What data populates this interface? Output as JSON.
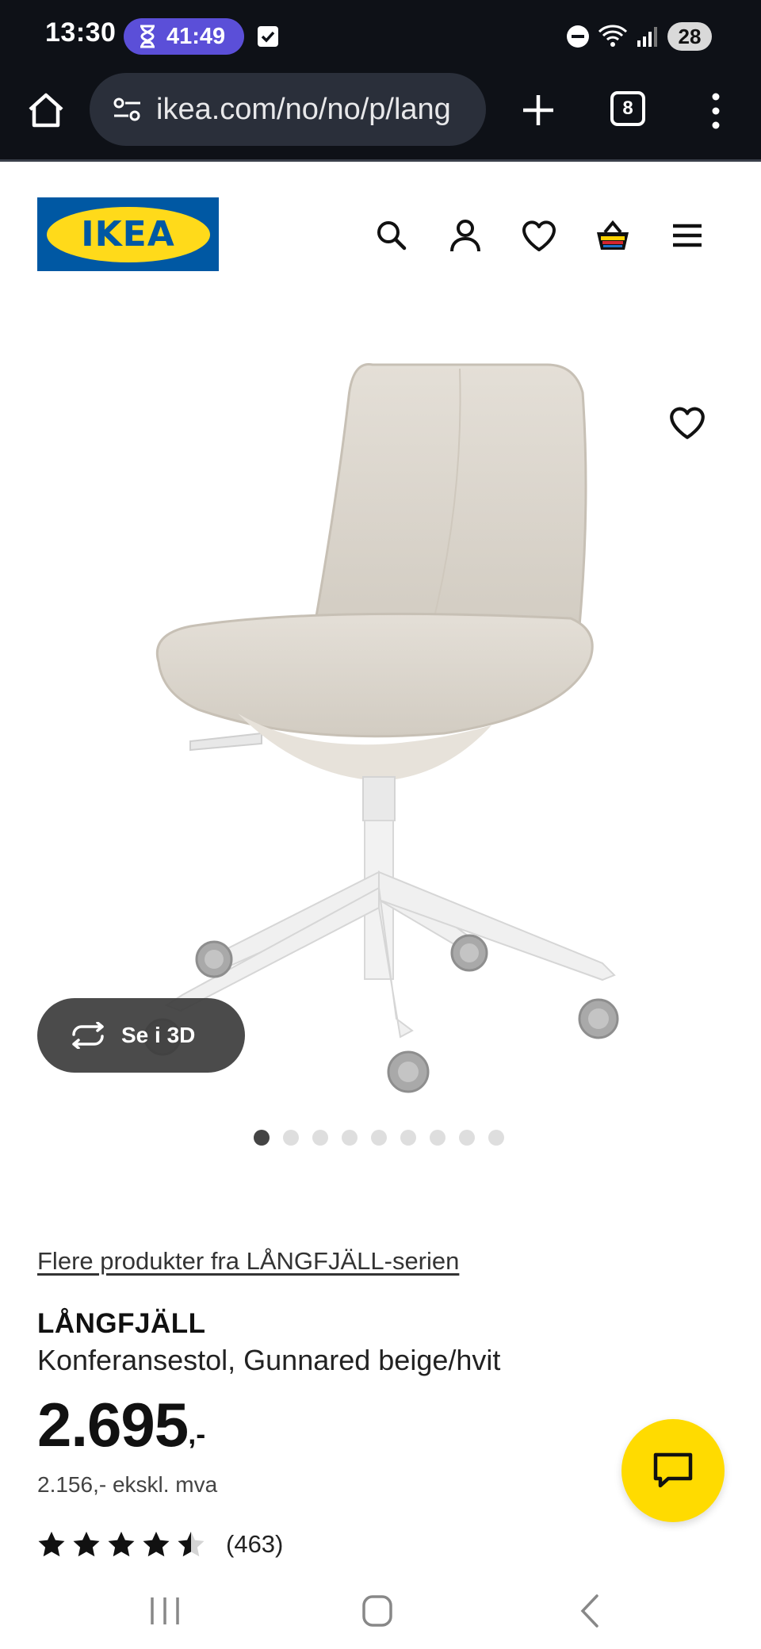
{
  "status_bar": {
    "time": "13:30",
    "timer": "41:49",
    "battery": "28"
  },
  "browser": {
    "url": "ikea.com/no/no/p/lang",
    "tab_count": "8"
  },
  "header": {
    "logo_text": "IKEA",
    "brand_blue": "#0058a3",
    "brand_yellow": "#ffda1a"
  },
  "gallery": {
    "view_3d_label": "Se i 3D",
    "dot_count": 9,
    "active_dot": 0
  },
  "product": {
    "series_link": "Flere produkter fra LÅNGFJÄLL-serien",
    "name": "LÅNGFJÄLL",
    "description": "Konferansestol, Gunnared beige/hvit",
    "price_main": "2.695",
    "price_suffix": ",-",
    "price_ex_vat": "2.156,- ekskl. mva",
    "rating": 4.5,
    "rating_count": "(463)"
  },
  "chat": {
    "color": "#ffdb00"
  }
}
